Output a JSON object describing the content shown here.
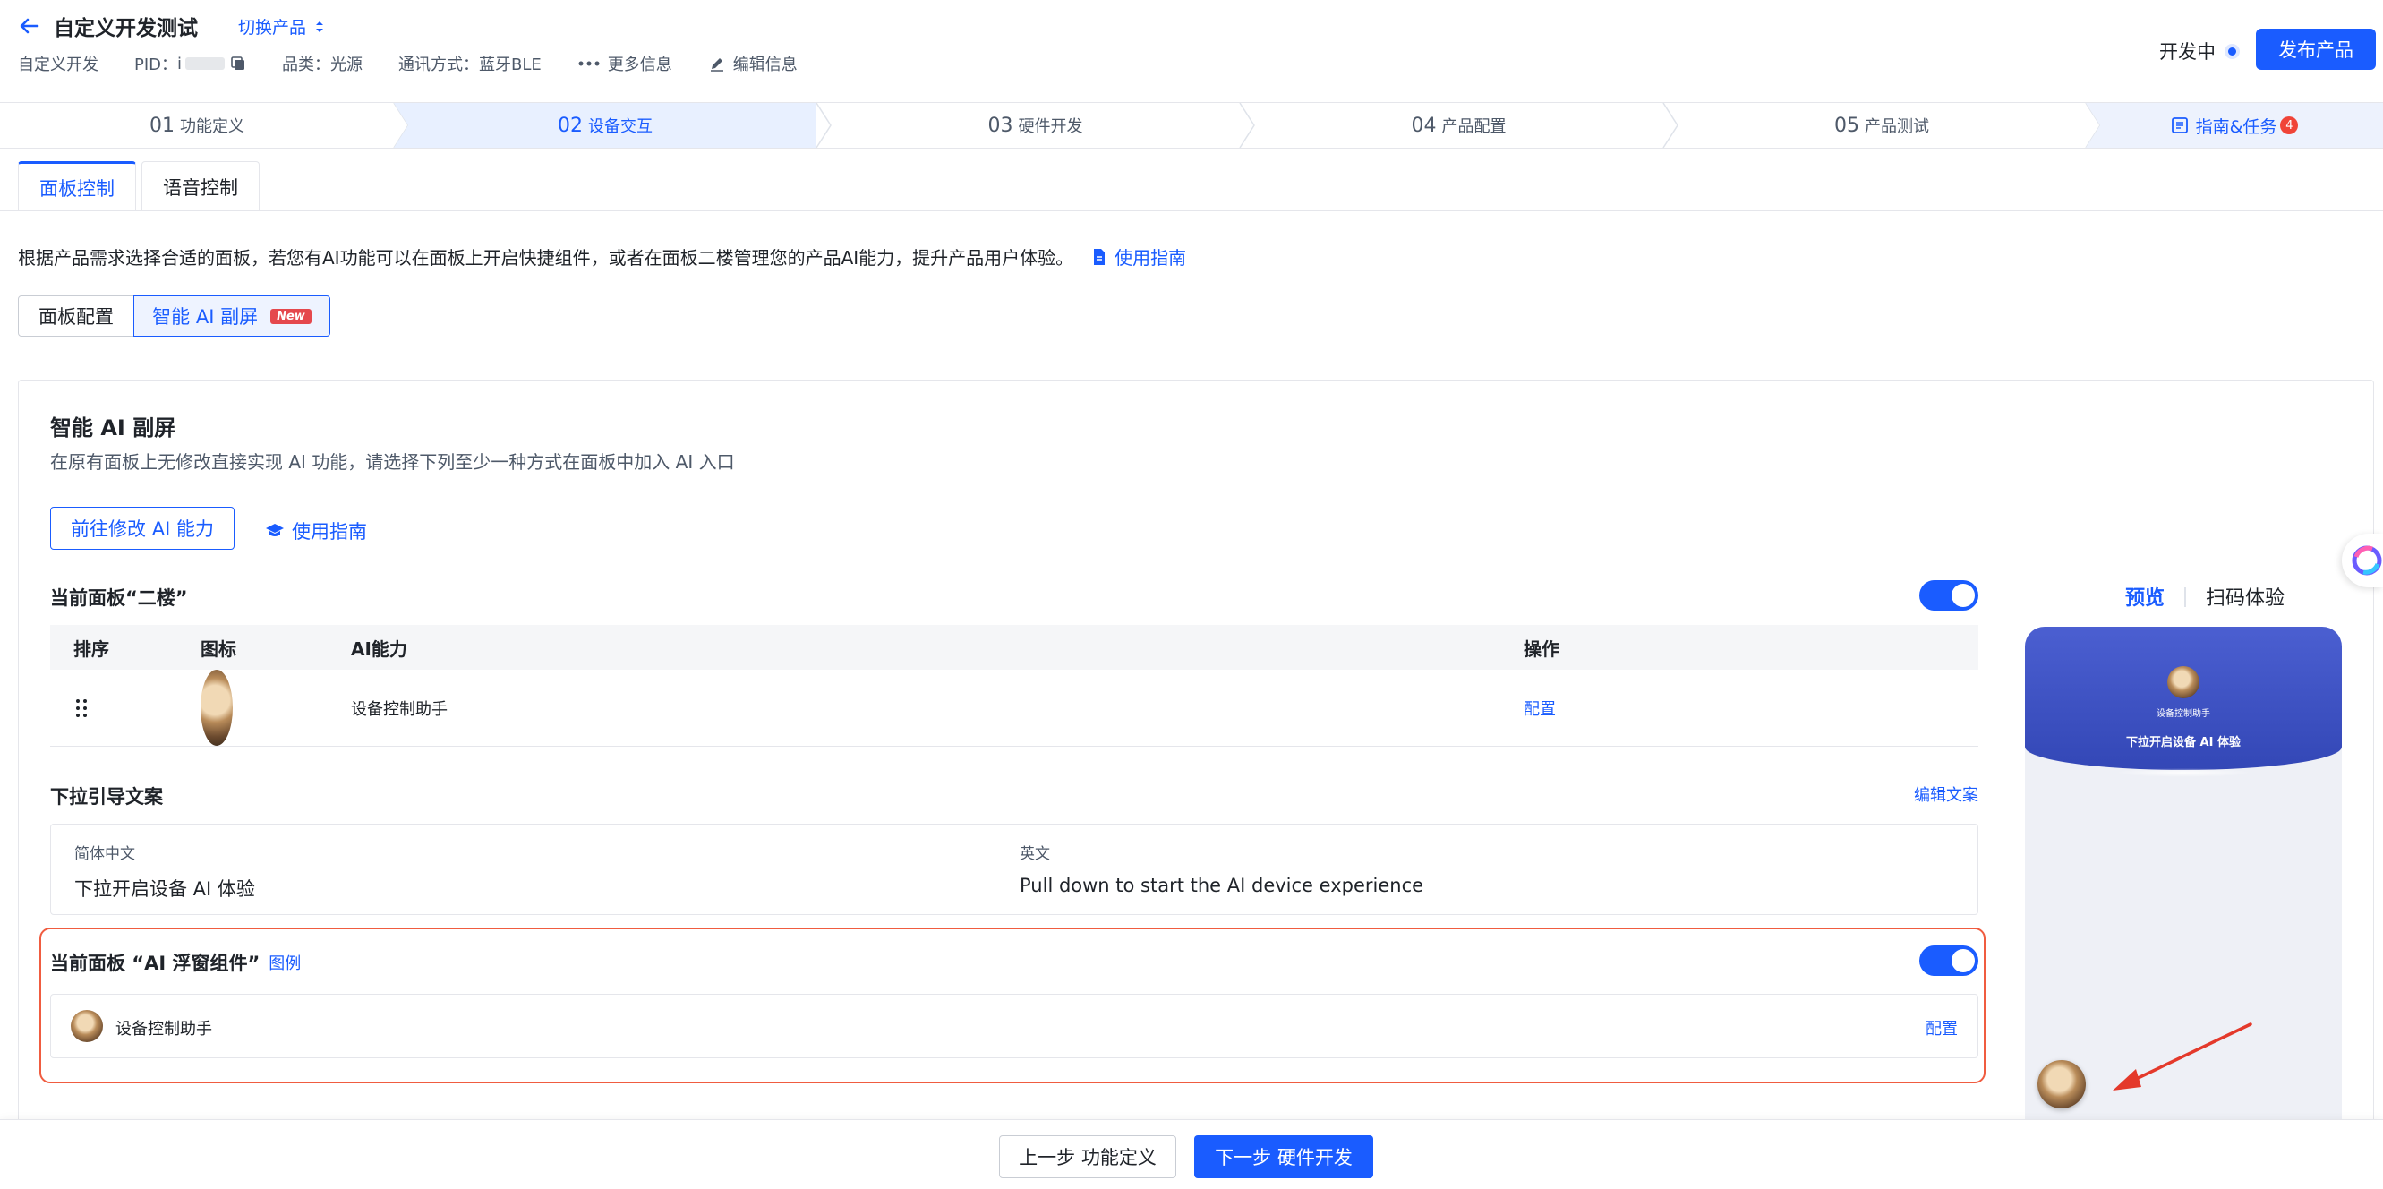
{
  "header": {
    "title": "自定义开发测试",
    "switch_product": "切换产品",
    "meta": {
      "dev_type": "自定义开发",
      "pid_label": "PID：",
      "pid_value": "i",
      "category": "品类：光源",
      "comm": "通讯方式：蓝牙BLE",
      "more": "更多信息",
      "edit": "编辑信息"
    },
    "status": "开发中",
    "publish": "发布产品"
  },
  "steps": [
    {
      "num": "01",
      "label": "功能定义"
    },
    {
      "num": "02",
      "label": "设备交互"
    },
    {
      "num": "03",
      "label": "硬件开发"
    },
    {
      "num": "04",
      "label": "产品配置"
    },
    {
      "num": "05",
      "label": "产品测试"
    }
  ],
  "guide_tasks": {
    "label": "指南&任务",
    "count": "4"
  },
  "tabs": {
    "panel": "面板控制",
    "voice": "语音控制"
  },
  "description": {
    "text": "根据产品需求选择合适的面板，若您有AI功能可以在面板上开启快捷组件，或者在面板二楼管理您的产品AI能力，提升产品用户体验。",
    "guide_link": "使用指南"
  },
  "segments": {
    "config": "面板配置",
    "ai": "智能 AI 副屏",
    "new_badge": "New"
  },
  "card": {
    "title": "智能 AI 副屏",
    "subtitle": "在原有面板上无修改直接实现 AI 功能，请选择下列至少一种方式在面板中加入 AI 入口",
    "modify_btn": "前往修改 AI 能力",
    "guide_link": "使用指南"
  },
  "second_floor": {
    "title": "当前面板“二楼”",
    "enabled": true,
    "columns": {
      "order": "排序",
      "icon": "图标",
      "ability": "AI能力",
      "action": "操作"
    },
    "rows": [
      {
        "name": "设备控制助手",
        "action": "配置"
      }
    ]
  },
  "pulldown": {
    "title": "下拉引导文案",
    "edit": "编辑文案",
    "zh_label": "简体中文",
    "zh_value": "下拉开启设备 AI 体验",
    "en_label": "英文",
    "en_value": "Pull down to start the AI device experience"
  },
  "floating": {
    "title": "当前面板 “AI 浮窗组件”",
    "example_link": "图例",
    "enabled": true,
    "item_name": "设备控制助手",
    "action": "配置"
  },
  "preview": {
    "tab_preview": "预览",
    "tab_scan": "扫码体验",
    "phone_assistant": "设备控制助手",
    "phone_hint": "下拉开启设备 AI 体验"
  },
  "footer": {
    "prev": "上一步 功能定义",
    "next": "下一步 硬件开发"
  },
  "colors": {
    "primary": "#1a5cff",
    "highlight_border": "#f05c40",
    "badge_red": "#f04438"
  }
}
